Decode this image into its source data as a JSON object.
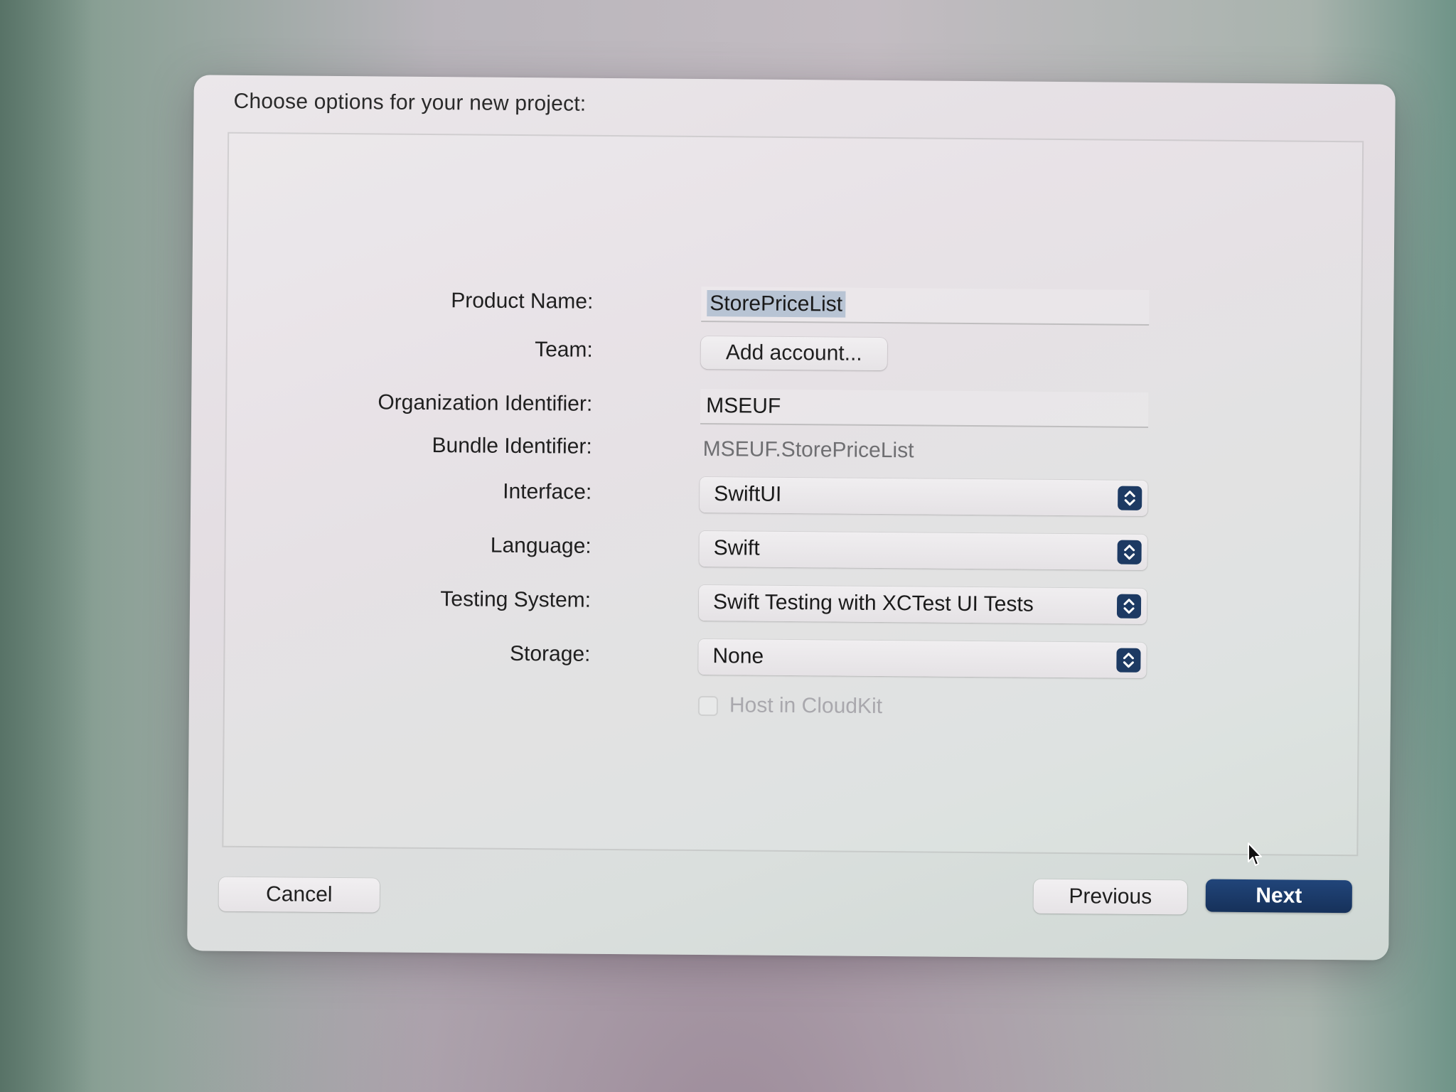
{
  "dialog": {
    "title": "Choose options for your new project:"
  },
  "form": {
    "product_name": {
      "label": "Product Name:",
      "value": "StorePriceList"
    },
    "team": {
      "label": "Team:",
      "button": "Add account..."
    },
    "organization_identifier": {
      "label": "Organization Identifier:",
      "value": "MSEUF"
    },
    "bundle_identifier": {
      "label": "Bundle Identifier:",
      "value": "MSEUF.StorePriceList"
    },
    "interface": {
      "label": "Interface:",
      "value": "SwiftUI"
    },
    "language": {
      "label": "Language:",
      "value": "Swift"
    },
    "testing_system": {
      "label": "Testing System:",
      "value": "Swift Testing with XCTest UI Tests"
    },
    "storage": {
      "label": "Storage:",
      "value": "None"
    },
    "cloudkit": {
      "label": "Host in CloudKit",
      "checked": false,
      "enabled": false
    }
  },
  "footer": {
    "cancel": "Cancel",
    "previous": "Previous",
    "next": "Next"
  },
  "colors": {
    "accent": "#1d3a63",
    "selection": "#b8c4d4",
    "disabled_text": "#a9a8ad"
  }
}
